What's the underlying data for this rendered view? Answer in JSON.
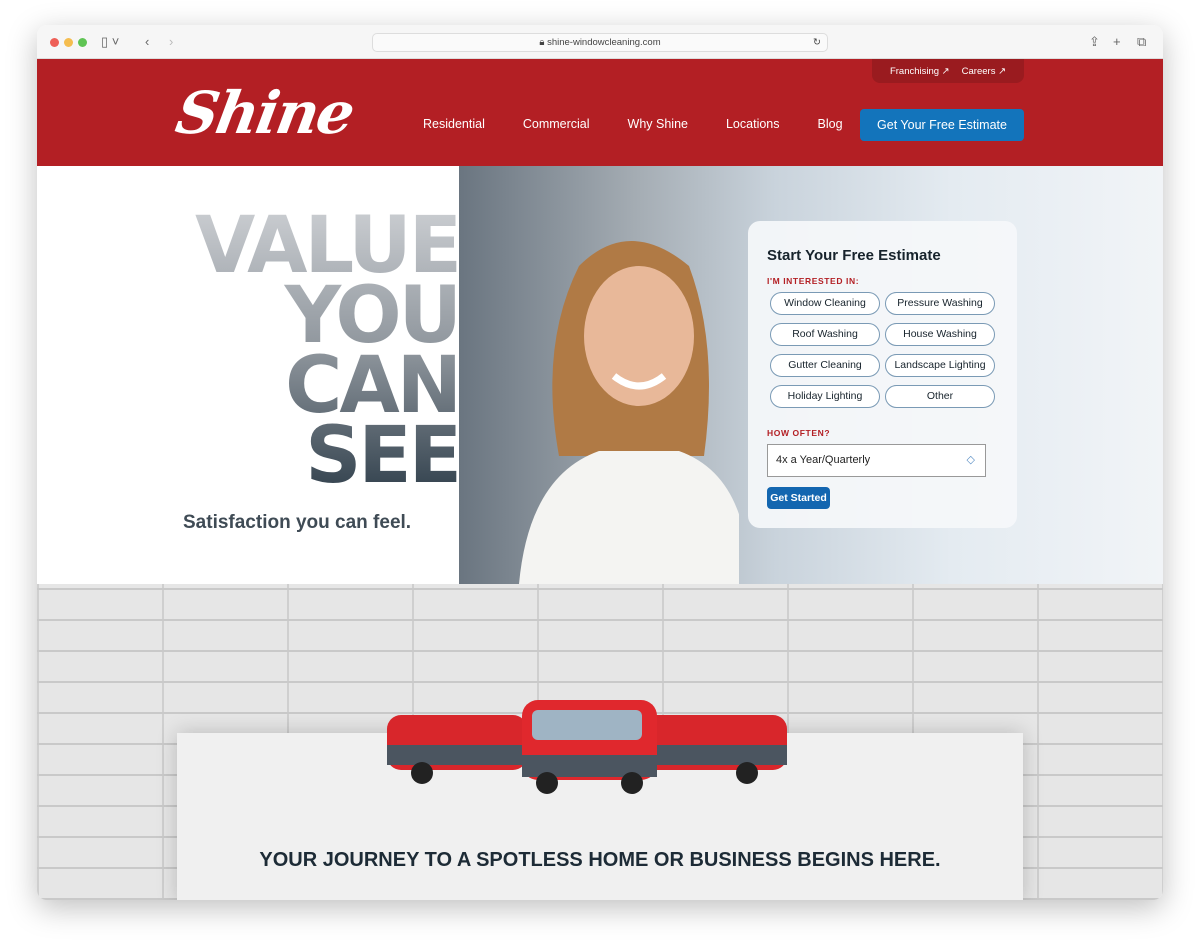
{
  "browser": {
    "url": "shine-windowcleaning.com"
  },
  "header": {
    "logo": "Shine",
    "top_links": [
      "Franchising ↗",
      "Careers ↗"
    ],
    "nav": [
      "Residential",
      "Commercial",
      "Why Shine",
      "Locations",
      "Blog"
    ],
    "cta": "Get Your Free Estimate",
    "brand_color": "#b31f24",
    "accent_color": "#1374bb"
  },
  "hero": {
    "headline": [
      "VALUE",
      "YOU",
      "CAN",
      "SEE"
    ],
    "tagline": "Satisfaction you can feel."
  },
  "form": {
    "title": "Start Your Free Estimate",
    "interest_label": "I'M INTERESTED IN:",
    "services": [
      "Window Cleaning",
      "Pressure Washing",
      "Roof Washing",
      "House Washing",
      "Gutter Cleaning",
      "Landscape Lighting",
      "Holiday Lighting",
      "Other"
    ],
    "frequency_label": "HOW OFTEN?",
    "frequency_value": "4x a Year/Quarterly",
    "submit": "Get Started"
  },
  "journey": {
    "heading": "YOUR JOURNEY TO A SPOTLESS HOME OR BUSINESS BEGINS HERE."
  }
}
